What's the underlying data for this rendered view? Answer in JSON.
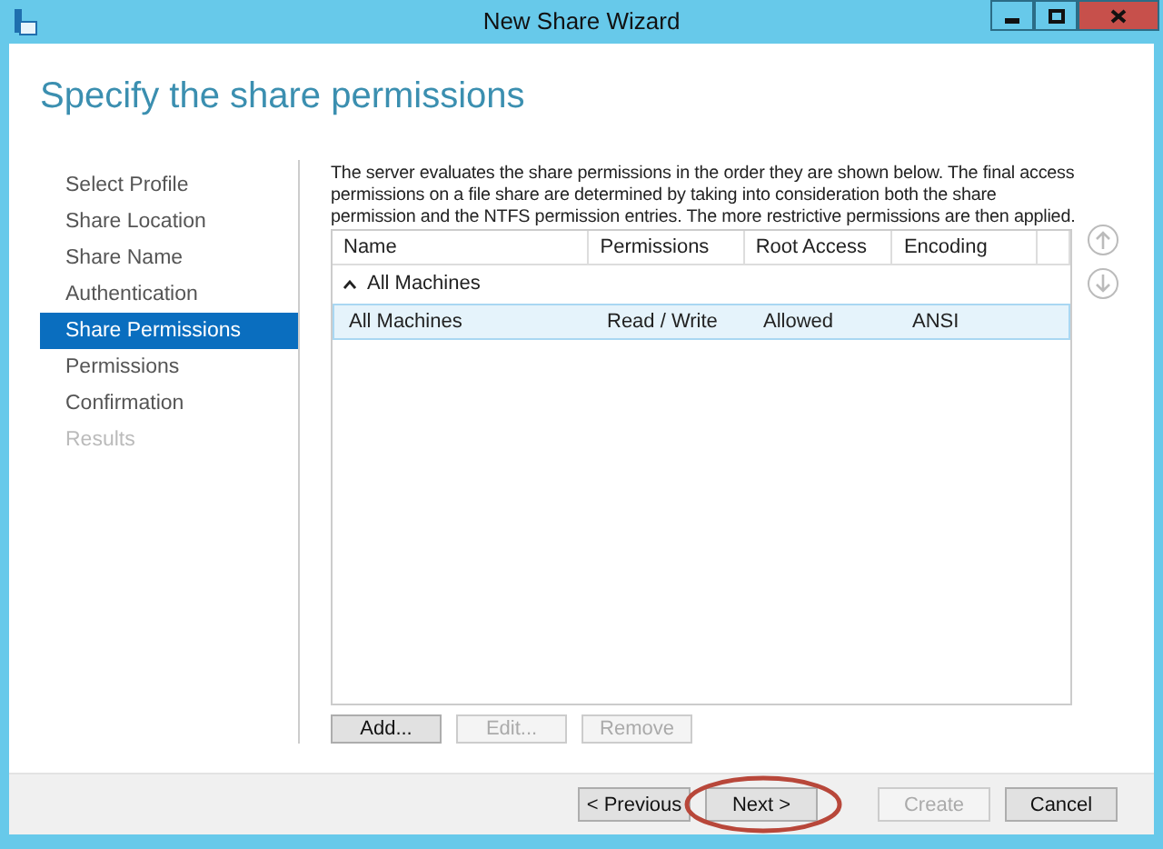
{
  "window": {
    "title": "New Share Wizard"
  },
  "heading": "Specify the share permissions",
  "nav": [
    {
      "label": "Select Profile",
      "selected": false,
      "disabled": false
    },
    {
      "label": "Share Location",
      "selected": false,
      "disabled": false
    },
    {
      "label": "Share Name",
      "selected": false,
      "disabled": false
    },
    {
      "label": "Authentication",
      "selected": false,
      "disabled": false
    },
    {
      "label": "Share Permissions",
      "selected": true,
      "disabled": false
    },
    {
      "label": "Permissions",
      "selected": false,
      "disabled": false
    },
    {
      "label": "Confirmation",
      "selected": false,
      "disabled": false
    },
    {
      "label": "Results",
      "selected": false,
      "disabled": true
    }
  ],
  "description": "The server evaluates the share permissions in the order they are shown below. The final access permissions on a file share are determined by taking into consideration both the share permission and the NTFS permission entries. The more restrictive permissions are then applied.",
  "table": {
    "columns": [
      "Name",
      "Permissions",
      "Root Access",
      "Encoding"
    ],
    "groups": [
      {
        "label": "All Machines",
        "expanded": true,
        "rows": [
          {
            "cells": [
              "All Machines",
              "Read / Write",
              "Allowed",
              "ANSI"
            ],
            "selected": true
          }
        ]
      }
    ]
  },
  "table_buttons": [
    {
      "label": "Add...",
      "disabled": false
    },
    {
      "label": "Edit...",
      "disabled": true
    },
    {
      "label": "Remove",
      "disabled": true
    }
  ],
  "footer_buttons": [
    {
      "label": "< Previous",
      "disabled": false,
      "highlighted": false
    },
    {
      "label": "Next >",
      "disabled": false,
      "highlighted": true
    },
    {
      "label": "Create",
      "disabled": true,
      "highlighted": false
    },
    {
      "label": "Cancel",
      "disabled": false,
      "highlighted": false
    }
  ]
}
